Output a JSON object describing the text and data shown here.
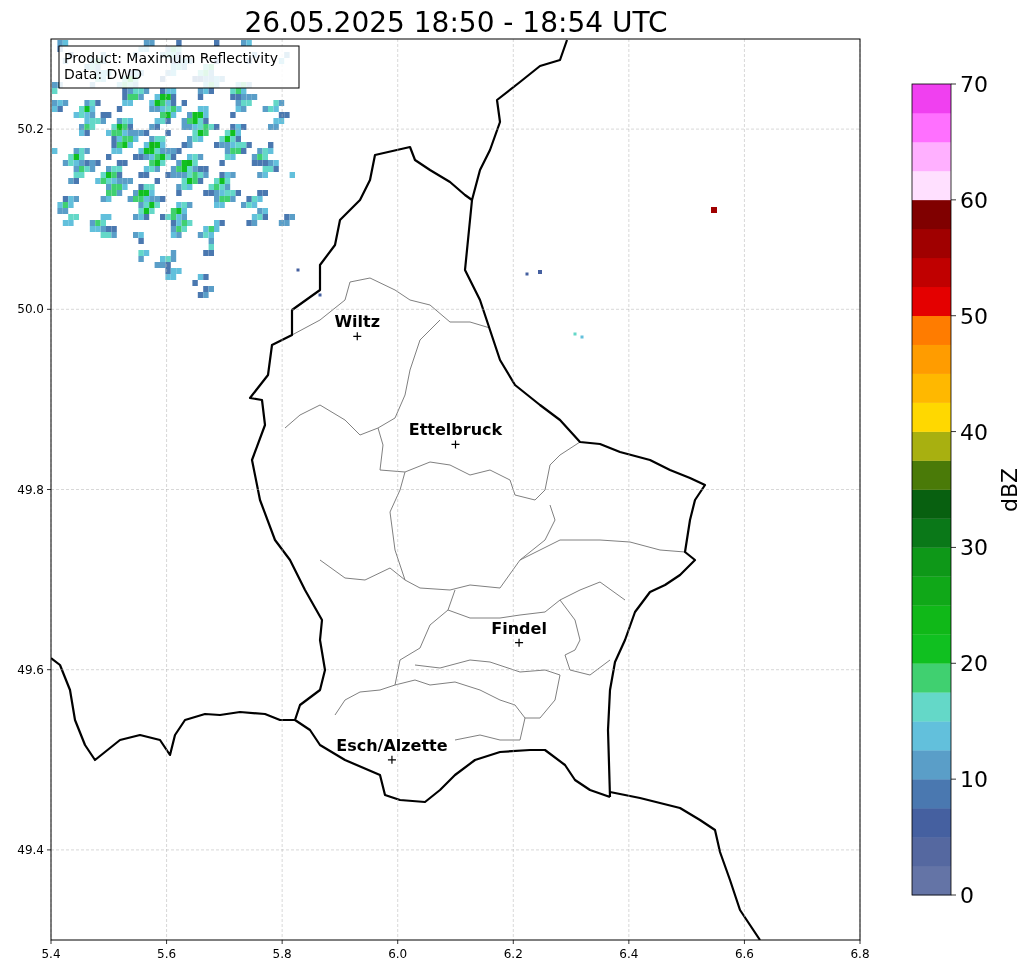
{
  "title": "26.05.2025 18:50 - 18:54 UTC",
  "info_box": [
    "Product: Maximum Reflectivity",
    "Data: DWD"
  ],
  "map": {
    "chart_data": {
      "type": "scatter",
      "x": [
        5.93,
        6.1,
        6.21,
        5.99
      ],
      "values": [
        49.97,
        49.85,
        49.63,
        49.5
      ],
      "grid": true,
      "xlim": [
        5.4,
        6.8
      ],
      "ylim": [
        49.3,
        50.3
      ],
      "xticks": [
        {
          "value": 5.4,
          "label": "5.4"
        },
        {
          "value": 5.6,
          "label": "5.6"
        },
        {
          "value": 5.8,
          "label": "5.8"
        },
        {
          "value": 6.0,
          "label": "6.0"
        },
        {
          "value": 6.2,
          "label": "6.2"
        },
        {
          "value": 6.4,
          "label": "6.4"
        },
        {
          "value": 6.6,
          "label": "6.6"
        },
        {
          "value": 6.8,
          "label": "6.8"
        }
      ],
      "yticks": [
        {
          "value": 49.4,
          "label": "49.4"
        },
        {
          "value": 49.6,
          "label": "49.6"
        },
        {
          "value": 49.8,
          "label": "49.8"
        },
        {
          "value": 50.0,
          "label": "50.0"
        },
        {
          "value": 50.2,
          "label": "50.2"
        }
      ],
      "annotations": [
        {
          "text": "Wiltz",
          "x": 5.93,
          "y": 49.97
        },
        {
          "text": "Ettelbruck",
          "x": 6.1,
          "y": 49.85
        },
        {
          "text": "Findel",
          "x": 6.21,
          "y": 49.63
        },
        {
          "text": "Esch/Alzette",
          "x": 5.99,
          "y": 49.5
        }
      ]
    }
  },
  "colorbar": {
    "label": "dBZ",
    "ticks": [
      "70",
      "60",
      "50",
      "40",
      "30",
      "20",
      "10",
      "0"
    ],
    "bands": [
      {
        "color": "#6474a6"
      },
      {
        "color": "#5568a0"
      },
      {
        "color": "#4560a0"
      },
      {
        "color": "#4a78b0"
      },
      {
        "color": "#5a9ec8"
      },
      {
        "color": "#62c0dc"
      },
      {
        "color": "#64d8c8"
      },
      {
        "color": "#40d070"
      },
      {
        "color": "#10c020"
      },
      {
        "color": "#10b818"
      },
      {
        "color": "#10a818"
      },
      {
        "color": "#0e9818"
      },
      {
        "color": "#0a7818"
      },
      {
        "color": "#086010"
      },
      {
        "color": "#4a7a08"
      },
      {
        "color": "#a8b010"
      },
      {
        "color": "#ffd800"
      },
      {
        "color": "#ffb800"
      },
      {
        "color": "#ff9c00"
      },
      {
        "color": "#ff7c00"
      },
      {
        "color": "#e40000"
      },
      {
        "color": "#c00000"
      },
      {
        "color": "#a00000"
      },
      {
        "color": "#800000"
      },
      {
        "color": "#ffe0ff"
      },
      {
        "color": "#ffb0ff"
      },
      {
        "color": "#ff70ff"
      },
      {
        "color": "#f040f0"
      }
    ]
  }
}
